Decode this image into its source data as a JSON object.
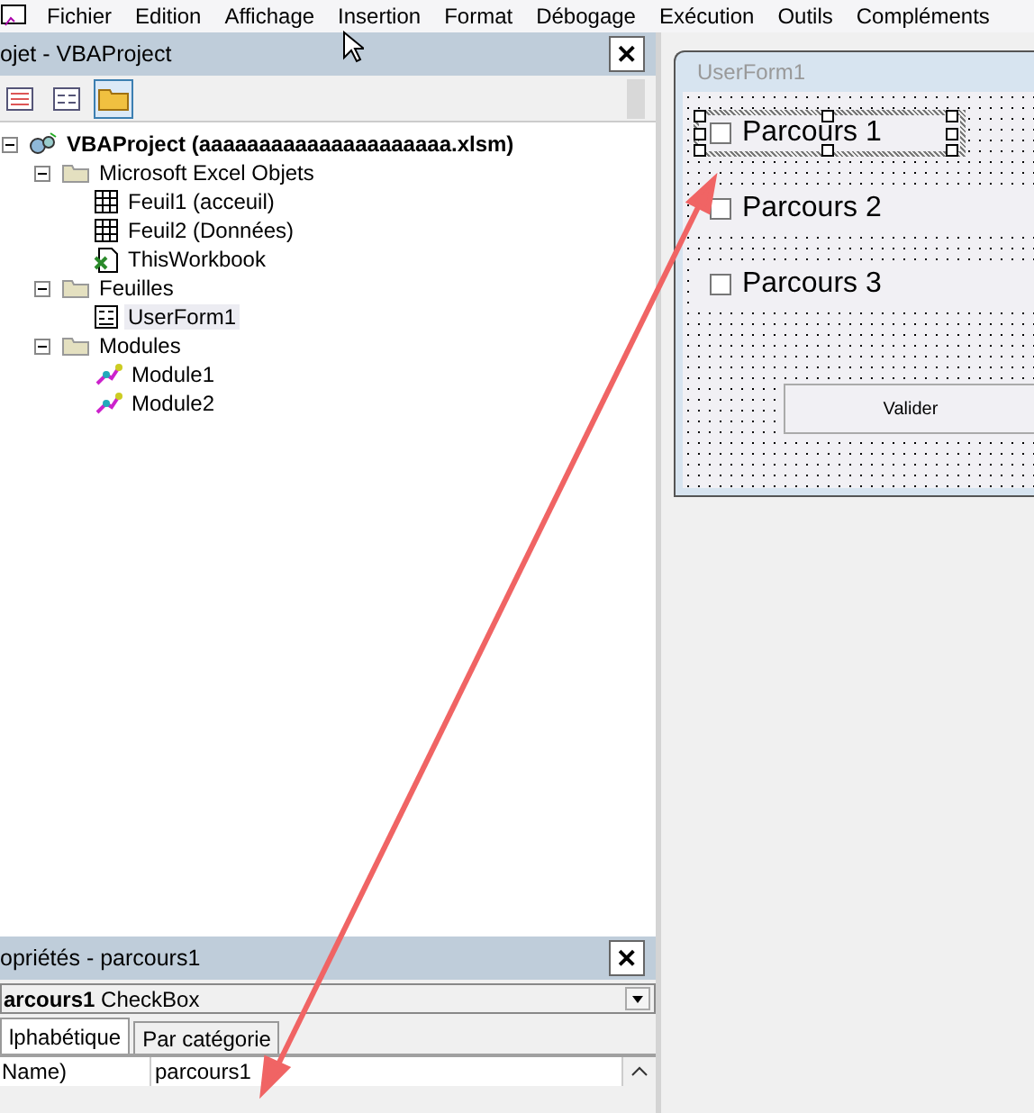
{
  "menu": [
    {
      "label": "Fichier"
    },
    {
      "label": "Edition"
    },
    {
      "label": "Affichage"
    },
    {
      "label": "Insertion"
    },
    {
      "label": "Format"
    },
    {
      "label": "Débogage"
    },
    {
      "label": "Exécution"
    },
    {
      "label": "Outils"
    },
    {
      "label": "Compléments"
    }
  ],
  "project_pane": {
    "title": "ojet - VBAProject",
    "close": "✕",
    "toolbar": [
      {
        "kind": "code",
        "selected": false
      },
      {
        "kind": "form",
        "selected": false
      },
      {
        "kind": "folder",
        "selected": true
      }
    ],
    "tree": [
      {
        "label": "VBAProject (aaaaaaaaaaaaaaaaaaaaa.xlsm)",
        "kind": "project",
        "expanded": true,
        "selected": false,
        "children": [
          {
            "label": "Microsoft Excel Objets",
            "kind": "folder",
            "expanded": true,
            "selected": false,
            "children": [
              {
                "label": "Feuil1 (acceuil)",
                "kind": "sheet",
                "selected": false
              },
              {
                "label": "Feuil2 (Données)",
                "kind": "sheet",
                "selected": false
              },
              {
                "label": "ThisWorkbook",
                "kind": "workbook",
                "selected": false
              }
            ]
          },
          {
            "label": "Feuilles",
            "kind": "folder",
            "expanded": true,
            "selected": false,
            "children": [
              {
                "label": "UserForm1",
                "kind": "form",
                "selected": true
              }
            ]
          },
          {
            "label": "Modules",
            "kind": "folder",
            "expanded": true,
            "selected": false,
            "children": [
              {
                "label": "Module1",
                "kind": "module",
                "selected": false
              },
              {
                "label": "Module2",
                "kind": "module",
                "selected": false
              }
            ]
          }
        ]
      }
    ]
  },
  "properties_pane": {
    "title": "opriétés - parcours1",
    "close": "✕",
    "object": "**arcours1** CheckBox",
    "tabs": [
      {
        "label": "lphabétique",
        "selected": true
      },
      {
        "label": "Par catégorie",
        "selected": false
      }
    ],
    "rows": [
      {
        "name": "Name)",
        "value": "parcours1"
      }
    ]
  },
  "userform": {
    "title": "UserForm1",
    "checkboxes": [
      {
        "label": "Parcours 1",
        "checked": false,
        "selected": true
      },
      {
        "label": "Parcours 2",
        "checked": false,
        "selected": false
      },
      {
        "label": "Parcours 3",
        "checked": false,
        "selected": false
      }
    ],
    "button": "Valider"
  }
}
